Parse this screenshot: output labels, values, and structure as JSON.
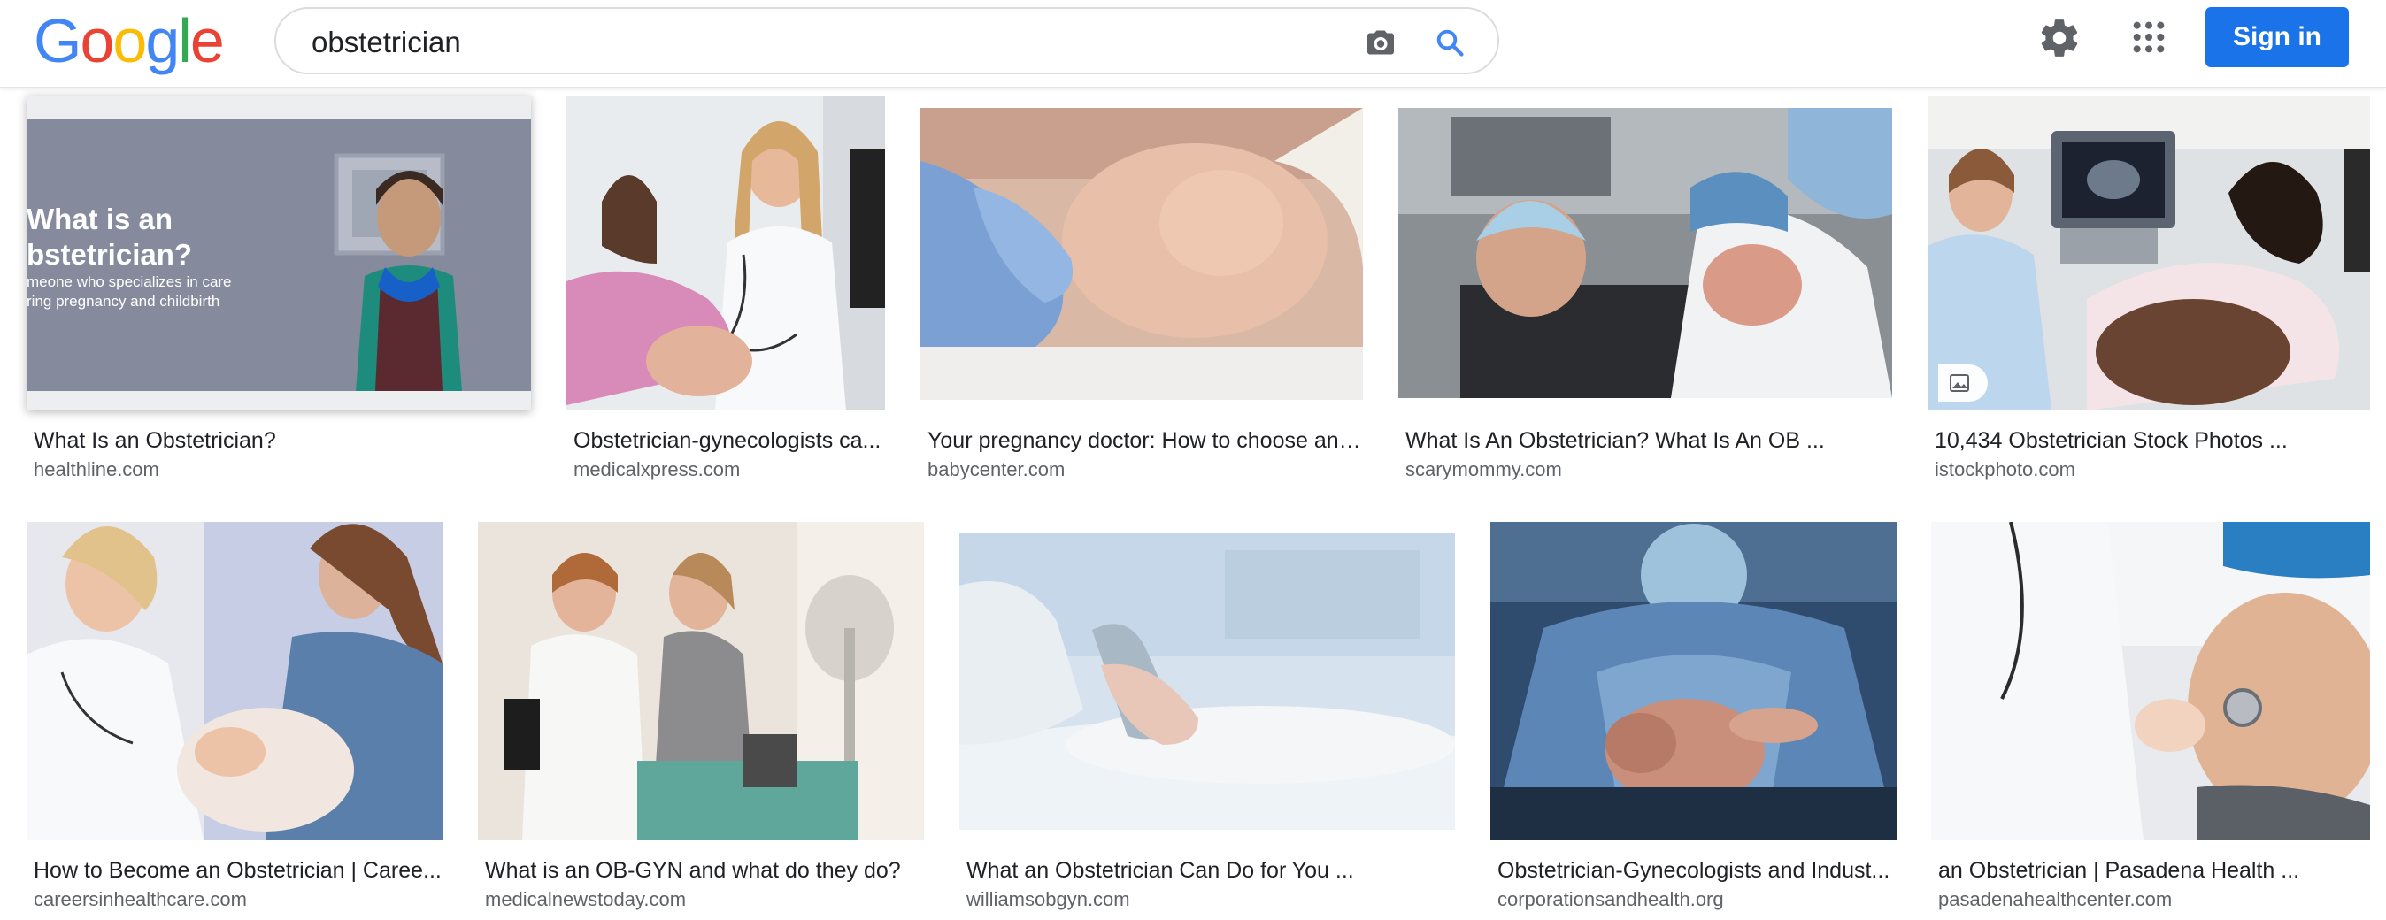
{
  "header": {
    "logo_letters": [
      "G",
      "o",
      "o",
      "g",
      "l",
      "e"
    ],
    "search": {
      "value": "obstetrician"
    },
    "sign_in_label": "Sign in"
  },
  "icons": {
    "camera": "camera-icon",
    "search": "search-icon",
    "settings": "gear-icon",
    "apps": "apps-grid-icon",
    "image_badge": "image-icon"
  },
  "colors": {
    "google_blue": "#4285F4",
    "google_red": "#EA4335",
    "google_yellow": "#FBBC05",
    "google_green": "#34A853",
    "sign_in_blue": "#1a73e8"
  },
  "results": [
    {
      "title": "What Is an Obstetrician?",
      "source": "healthline.com",
      "overlay_heading": "What is an",
      "overlay_heading2": "bstetrician?",
      "overlay_sub1": "meone who specializes in care",
      "overlay_sub2": "ring pregnancy and childbirth"
    },
    {
      "title": "Obstetrician-gynecologists ca...",
      "source": "medicalxpress.com"
    },
    {
      "title": "Your pregnancy doctor: How to choose an ...",
      "source": "babycenter.com"
    },
    {
      "title": "What Is An Obstetrician? What Is An OB ...",
      "source": "scarymommy.com"
    },
    {
      "title": "10,434 Obstetrician Stock Photos ...",
      "source": "istockphoto.com"
    },
    {
      "title": "How to Become an Obstetrician | Caree...",
      "source": "careersinhealthcare.com"
    },
    {
      "title": "What is an OB-GYN and what do they do?",
      "source": "medicalnewstoday.com"
    },
    {
      "title": "What an Obstetrician Can Do for You ...",
      "source": "williamsobgyn.com"
    },
    {
      "title": "Obstetrician-Gynecologists and Indust...",
      "source": "corporationsandhealth.org"
    },
    {
      "title": "an Obstetrician | Pasadena Health ...",
      "source": "pasadenahealthcenter.com"
    }
  ]
}
